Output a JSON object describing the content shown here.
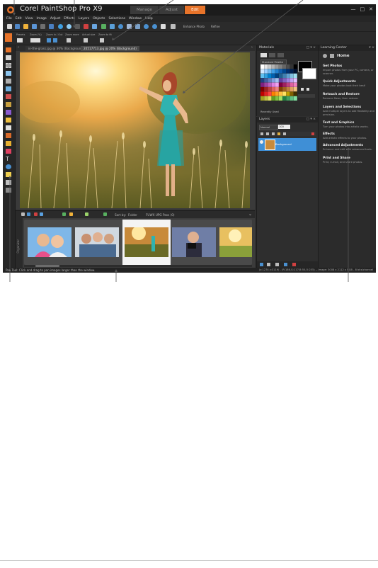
{
  "app": {
    "title": "Corel PaintShop Pro X9",
    "tabs": [
      "Manage",
      "Adjust",
      "Edit"
    ],
    "active_tab": "Edit",
    "accent_color": "#e8742a"
  },
  "menu": [
    "File",
    "Edit",
    "View",
    "Image",
    "Adjust",
    "Effects",
    "Layers",
    "Objects",
    "Selections",
    "Window",
    "Help"
  ],
  "toolbar": {
    "enhance_photo": "Enhance Photo",
    "refine": "Refine"
  },
  "tool_options": {
    "labels": [
      "Presets",
      "Zoom (%)",
      "Zoom In / Out",
      "Zoom more",
      "Actual size",
      "Zoom to fit"
    ]
  },
  "documents": {
    "tabs": [
      "in-the-grass.jpg @ 30% (Background)",
      "20517713.jpg @ 20% (Background)"
    ],
    "active_index": 1
  },
  "organizer": {
    "side_label": "Organizer",
    "sort_label": "Sort by:",
    "sort_value": "Folder",
    "filter_value": "FUWX UPG Pass (0)",
    "thumb_count": 5,
    "selected_index": 2
  },
  "status": {
    "left": "Pan Tool: Click and drag to pan images larger than the window.",
    "right": "(x:1274 y:3119) - (R:186,G:117,B:55,O:255) -- Image: 3008 x 2112 x RGB - 8 bits/channel"
  },
  "materials": {
    "title": "Materials",
    "palette": "Standard Palette",
    "recently_used": "Recently Used",
    "fg_color": "#000000",
    "bg_color": "#ffffff"
  },
  "layers": {
    "title": "Layers",
    "blend_mode": "Normal",
    "opacity": "100",
    "layer_name": "Background"
  },
  "learning_center": {
    "title": "Learning Center",
    "home": "Home",
    "sections": [
      {
        "title": "Get Photos",
        "desc": "Import photos from your PC, camera, or scanner."
      },
      {
        "title": "Quick Adjustments",
        "desc": "Make your photos look their best!"
      },
      {
        "title": "Retouch and Restore",
        "desc": "Remove flaws, then restore."
      },
      {
        "title": "Layers and Selections",
        "desc": "Add multiple layers to add flexibility and precision."
      },
      {
        "title": "Text and Graphics",
        "desc": "Turn your photos into artistic works."
      },
      {
        "title": "Effects",
        "desc": "Add artistic effects to your photos."
      },
      {
        "title": "Advanced Adjustments",
        "desc": "Enhance and edit with advanced tools."
      },
      {
        "title": "Print and Share",
        "desc": "Print, e-mail, and share photos."
      }
    ]
  }
}
